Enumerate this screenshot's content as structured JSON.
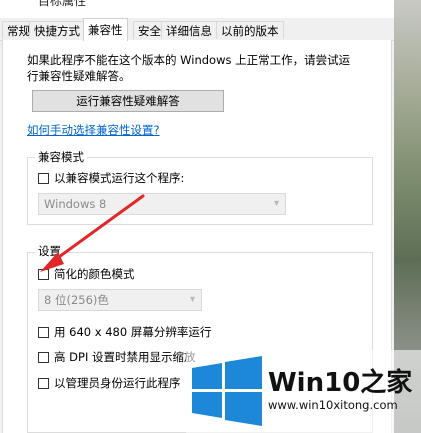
{
  "window": {
    "title": "“ 目标属性"
  },
  "tabs": [
    {
      "label": "常规"
    },
    {
      "label": "快捷方式"
    },
    {
      "label": "兼容性"
    },
    {
      "label": "安全"
    },
    {
      "label": "详细信息"
    },
    {
      "label": "以前的版本"
    }
  ],
  "intro_text": "如果此程序不能在这个版本的 Windows 上正常工作，请尝试运行兼容性疑难解答。",
  "troubleshoot_button": "运行兼容性疑难解答",
  "manual_link": "如何手动选择兼容性设置?",
  "compat_mode": {
    "title": "兼容模式",
    "checkbox_label": "以兼容模式运行这个程序:",
    "checked": false,
    "select_value": "Windows 8"
  },
  "settings": {
    "title": "设置",
    "reduced_color": {
      "label": "简化的颜色模式",
      "checked": false
    },
    "color_select": "8 位(256)色",
    "res_640": {
      "label": "用 640 x 480 屏幕分辨率运行",
      "checked": false
    },
    "dpi": {
      "label": "高 DPI 设置时禁用显示缩放",
      "checked": false
    },
    "admin": {
      "label": "以管理员身份运行此程序",
      "checked": false
    }
  },
  "watermark": {
    "main": "Win10之家",
    "url": "www.win10xitong.com",
    "colors": {
      "blue": "#1e88d8",
      "arrow": "#e0282a"
    }
  }
}
